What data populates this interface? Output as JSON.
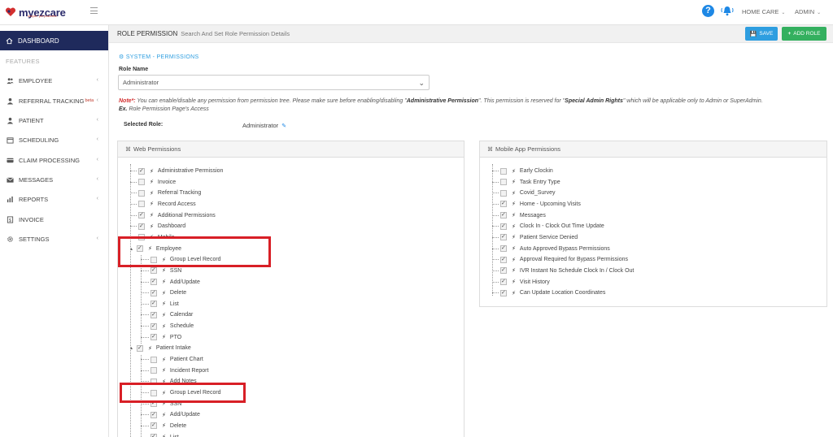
{
  "brand": {
    "name": "myezcare",
    "tagline": "simple. yet powerful."
  },
  "topbar": {
    "agency": "HOME CARE",
    "user": "ADMIN"
  },
  "sidebar": {
    "active": "DASHBOARD",
    "section": "FEATURES",
    "items": [
      {
        "label": "EMPLOYEE",
        "icon": "users-icon",
        "chevron": true
      },
      {
        "label": "REFERRAL TRACKING",
        "icon": "user-icon",
        "badge": "beta",
        "chevron": true
      },
      {
        "label": "PATIENT",
        "icon": "user-icon",
        "chevron": true
      },
      {
        "label": "SCHEDULING",
        "icon": "calendar-icon",
        "chevron": true
      },
      {
        "label": "CLAIM PROCESSING",
        "icon": "card-icon",
        "chevron": true
      },
      {
        "label": "MESSAGES",
        "icon": "envelope-icon",
        "chevron": true
      },
      {
        "label": "REPORTS",
        "icon": "bar-chart-icon",
        "chevron": true
      },
      {
        "label": "INVOICE",
        "icon": "invoice-icon",
        "chevron": false
      },
      {
        "label": "SETTINGS",
        "icon": "gear-icon",
        "chevron": true
      }
    ]
  },
  "header": {
    "title": "ROLE PERMISSION",
    "subtitle": "Search And Set Role Permission Details",
    "save_label": "SAVE",
    "add_role_label": "ADD ROLE"
  },
  "content": {
    "section_title": "SYSTEM - PERMISSIONS",
    "role_name_label": "Role Name",
    "role_name_value": "Administrator",
    "note_prefix": "Note*:",
    "note_part1": " You can enable/disable any permission from permission tree. Please make sure before enabling/disabling \"",
    "note_admin": "Administrative Permission",
    "note_part2": "\". This permission is reserved for \"",
    "note_special": "Special Admin Rights",
    "note_part3": "\" which will be applicable only to Admin or SuperAdmin. ",
    "note_ex": "Ex.",
    "note_part4": " Role Permission Page's Access",
    "selected_role_label": "Selected Role:",
    "selected_role_value": "Administrator"
  },
  "web_panel": {
    "title": "Web Permissions",
    "nodes": [
      {
        "label": "Administrative Permission",
        "checked": true,
        "level": 0
      },
      {
        "label": "Invoice",
        "checked": false,
        "level": 0
      },
      {
        "label": "Referral Tracking",
        "checked": false,
        "level": 0
      },
      {
        "label": "Record Access",
        "checked": false,
        "level": 0
      },
      {
        "label": "Additional Permissions",
        "checked": true,
        "level": 0
      },
      {
        "label": "Dashboard",
        "checked": true,
        "level": 0
      },
      {
        "label": "Mobile",
        "checked": false,
        "level": 0
      },
      {
        "label": "Employee",
        "checked": true,
        "level": 0,
        "expander": true
      },
      {
        "label": "Group Level Record",
        "checked": false,
        "level": 1
      },
      {
        "label": "SSN",
        "checked": true,
        "level": 1
      },
      {
        "label": "Add/Update",
        "checked": true,
        "level": 1
      },
      {
        "label": "Delete",
        "checked": true,
        "level": 1
      },
      {
        "label": "List",
        "checked": true,
        "level": 1
      },
      {
        "label": "Calendar",
        "checked": true,
        "level": 1
      },
      {
        "label": "Schedule",
        "checked": true,
        "level": 1
      },
      {
        "label": "PTO",
        "checked": true,
        "level": 1
      },
      {
        "label": "Patient Intake",
        "checked": true,
        "level": 0,
        "expander": true
      },
      {
        "label": "Patient Chart",
        "checked": false,
        "level": 1
      },
      {
        "label": "Incident Report",
        "checked": false,
        "level": 1
      },
      {
        "label": "Add Notes",
        "checked": false,
        "level": 1
      },
      {
        "label": "Group Level Record",
        "checked": false,
        "level": 1
      },
      {
        "label": "SSN",
        "checked": true,
        "level": 1
      },
      {
        "label": "Add/Update",
        "checked": true,
        "level": 1
      },
      {
        "label": "Delete",
        "checked": true,
        "level": 1
      },
      {
        "label": "List",
        "checked": true,
        "level": 1
      }
    ]
  },
  "mobile_panel": {
    "title": "Mobile App Permissions",
    "nodes": [
      {
        "label": "Early Clockin",
        "checked": false
      },
      {
        "label": "Task Entry Type",
        "checked": false
      },
      {
        "label": "Covid_Survey",
        "checked": false
      },
      {
        "label": "Home - Upcoming Visits",
        "checked": true
      },
      {
        "label": "Messages",
        "checked": true
      },
      {
        "label": "Clock In - Clock Out Time Update",
        "checked": true
      },
      {
        "label": "Patient Service Denied",
        "checked": true
      },
      {
        "label": "Auto Approved Bypass Permissions",
        "checked": true
      },
      {
        "label": "Approval Required for Bypass Permissions",
        "checked": true
      },
      {
        "label": "IVR Instant No Schedule Clock In / Clock Out",
        "checked": true
      },
      {
        "label": "Visit History",
        "checked": true
      },
      {
        "label": "Can Update Location Coordinates",
        "checked": true
      }
    ]
  },
  "colors": {
    "sidebar_active": "#1f2a5c",
    "save": "#2e9ee0",
    "add_role": "#34b05f",
    "highlight": "#d81f26",
    "accent": "#2e9ee0"
  }
}
